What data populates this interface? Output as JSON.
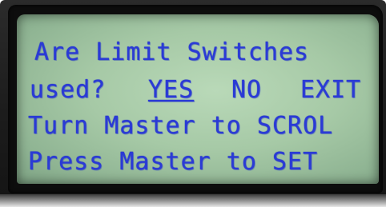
{
  "display": {
    "line1": "Are Limit Switches",
    "line2": {
      "question": "used?",
      "options": {
        "yes": "YES",
        "no": "NO",
        "exit": "EXIT"
      }
    },
    "line3": "Turn Master to SCROL",
    "line4": "Press Master to SET"
  },
  "colors": {
    "lcd_background": "#a6c9a6",
    "lcd_text": "#2a3ad6",
    "bezel": "#0d0d0d"
  }
}
